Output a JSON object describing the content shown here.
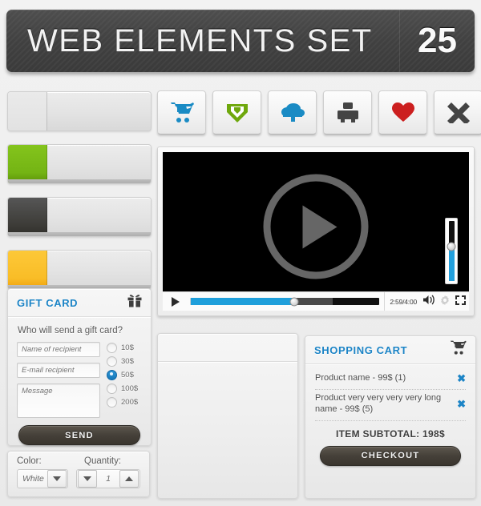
{
  "header": {
    "title": "WEB ELEMENTS SET",
    "number": "25"
  },
  "icon_buttons": [
    {
      "name": "shopping-cart-icon",
      "label": "Shopping cart",
      "color": "#1a8bc4"
    },
    {
      "name": "download-shield-icon",
      "label": "Download",
      "color": "#6fa80d"
    },
    {
      "name": "cloud-upload-icon",
      "label": "Cloud upload",
      "color": "#1a8bc4"
    },
    {
      "name": "printer-icon",
      "label": "Print",
      "color": "#444444"
    },
    {
      "name": "heart-icon",
      "label": "Favorite",
      "color": "#cc1f1f"
    },
    {
      "name": "close-x-icon",
      "label": "Close",
      "color": "#444444"
    }
  ],
  "progress_bars": [
    {
      "name": "progress-bar-empty",
      "variant": "empty",
      "percent": 27
    },
    {
      "name": "progress-bar-green",
      "variant": "green",
      "percent": 27
    },
    {
      "name": "progress-bar-dark",
      "variant": "dark",
      "percent": 27
    },
    {
      "name": "progress-bar-amber",
      "variant": "amber",
      "percent": 27
    }
  ],
  "gift_card": {
    "title": "GIFT CARD",
    "icon": "gift-icon",
    "question": "Who will send a gift card?",
    "fields": {
      "name_placeholder": "Name of recipient",
      "email_placeholder": "E-mail recipient",
      "message_placeholder": "Message"
    },
    "amounts": [
      {
        "label": "10$",
        "selected": false
      },
      {
        "label": "30$",
        "selected": false
      },
      {
        "label": "50$",
        "selected": true
      },
      {
        "label": "100$",
        "selected": false
      },
      {
        "label": "200$",
        "selected": false
      }
    ],
    "send_label": "SEND"
  },
  "color_quantity": {
    "color_label": "Color:",
    "quantity_label": "Quantity:",
    "color_value": "White",
    "quantity_value": "1"
  },
  "video_player": {
    "time": "2:59/4:00",
    "played_percent": 55,
    "buffered_percent": 75,
    "volume_percent": 58,
    "play_icon": "play-icon",
    "volume_icon": "volume-icon",
    "settings_icon": "gear-icon",
    "fullscreen_icon": "fullscreen-icon"
  },
  "shopping_cart": {
    "title": "SHOPPING CART",
    "icon": "cart-icon",
    "items": [
      {
        "name": "Product name - 99$ (1)",
        "remove": "✖"
      },
      {
        "name": "Product very very very very long name - 99$ (5)",
        "remove": "✖"
      }
    ],
    "subtotal": "ITEM SUBTOTAL: 198$",
    "checkout_label": "CHECKOUT"
  },
  "colors": {
    "accent_blue": "#1c84c6",
    "green": "#6fa80d",
    "red": "#cc1f1f",
    "dark": "#444444",
    "amber": "#f9bd27"
  }
}
